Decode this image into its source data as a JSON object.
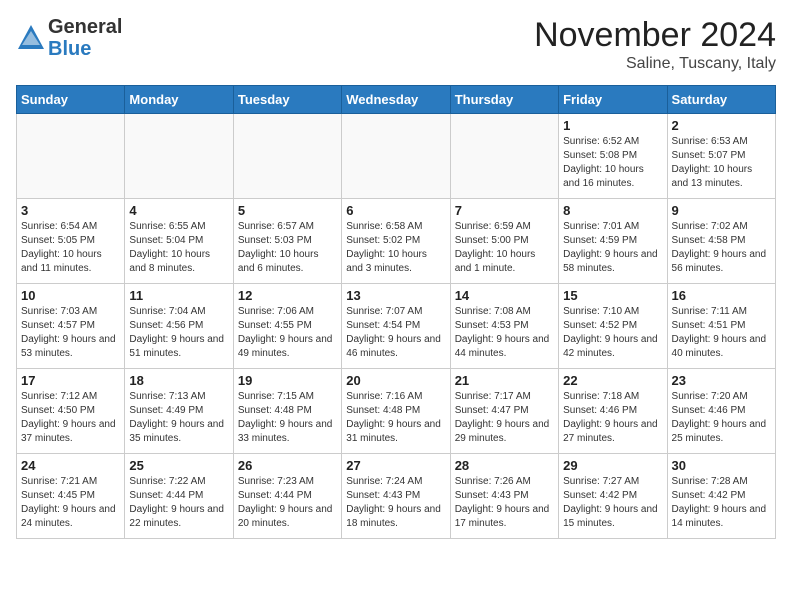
{
  "header": {
    "logo_line1": "General",
    "logo_line2": "Blue",
    "month": "November 2024",
    "location": "Saline, Tuscany, Italy"
  },
  "columns": [
    "Sunday",
    "Monday",
    "Tuesday",
    "Wednesday",
    "Thursday",
    "Friday",
    "Saturday"
  ],
  "weeks": [
    [
      {
        "day": "",
        "info": ""
      },
      {
        "day": "",
        "info": ""
      },
      {
        "day": "",
        "info": ""
      },
      {
        "day": "",
        "info": ""
      },
      {
        "day": "",
        "info": ""
      },
      {
        "day": "1",
        "info": "Sunrise: 6:52 AM\nSunset: 5:08 PM\nDaylight: 10 hours and 16 minutes."
      },
      {
        "day": "2",
        "info": "Sunrise: 6:53 AM\nSunset: 5:07 PM\nDaylight: 10 hours and 13 minutes."
      }
    ],
    [
      {
        "day": "3",
        "info": "Sunrise: 6:54 AM\nSunset: 5:05 PM\nDaylight: 10 hours and 11 minutes."
      },
      {
        "day": "4",
        "info": "Sunrise: 6:55 AM\nSunset: 5:04 PM\nDaylight: 10 hours and 8 minutes."
      },
      {
        "day": "5",
        "info": "Sunrise: 6:57 AM\nSunset: 5:03 PM\nDaylight: 10 hours and 6 minutes."
      },
      {
        "day": "6",
        "info": "Sunrise: 6:58 AM\nSunset: 5:02 PM\nDaylight: 10 hours and 3 minutes."
      },
      {
        "day": "7",
        "info": "Sunrise: 6:59 AM\nSunset: 5:00 PM\nDaylight: 10 hours and 1 minute."
      },
      {
        "day": "8",
        "info": "Sunrise: 7:01 AM\nSunset: 4:59 PM\nDaylight: 9 hours and 58 minutes."
      },
      {
        "day": "9",
        "info": "Sunrise: 7:02 AM\nSunset: 4:58 PM\nDaylight: 9 hours and 56 minutes."
      }
    ],
    [
      {
        "day": "10",
        "info": "Sunrise: 7:03 AM\nSunset: 4:57 PM\nDaylight: 9 hours and 53 minutes."
      },
      {
        "day": "11",
        "info": "Sunrise: 7:04 AM\nSunset: 4:56 PM\nDaylight: 9 hours and 51 minutes."
      },
      {
        "day": "12",
        "info": "Sunrise: 7:06 AM\nSunset: 4:55 PM\nDaylight: 9 hours and 49 minutes."
      },
      {
        "day": "13",
        "info": "Sunrise: 7:07 AM\nSunset: 4:54 PM\nDaylight: 9 hours and 46 minutes."
      },
      {
        "day": "14",
        "info": "Sunrise: 7:08 AM\nSunset: 4:53 PM\nDaylight: 9 hours and 44 minutes."
      },
      {
        "day": "15",
        "info": "Sunrise: 7:10 AM\nSunset: 4:52 PM\nDaylight: 9 hours and 42 minutes."
      },
      {
        "day": "16",
        "info": "Sunrise: 7:11 AM\nSunset: 4:51 PM\nDaylight: 9 hours and 40 minutes."
      }
    ],
    [
      {
        "day": "17",
        "info": "Sunrise: 7:12 AM\nSunset: 4:50 PM\nDaylight: 9 hours and 37 minutes."
      },
      {
        "day": "18",
        "info": "Sunrise: 7:13 AM\nSunset: 4:49 PM\nDaylight: 9 hours and 35 minutes."
      },
      {
        "day": "19",
        "info": "Sunrise: 7:15 AM\nSunset: 4:48 PM\nDaylight: 9 hours and 33 minutes."
      },
      {
        "day": "20",
        "info": "Sunrise: 7:16 AM\nSunset: 4:48 PM\nDaylight: 9 hours and 31 minutes."
      },
      {
        "day": "21",
        "info": "Sunrise: 7:17 AM\nSunset: 4:47 PM\nDaylight: 9 hours and 29 minutes."
      },
      {
        "day": "22",
        "info": "Sunrise: 7:18 AM\nSunset: 4:46 PM\nDaylight: 9 hours and 27 minutes."
      },
      {
        "day": "23",
        "info": "Sunrise: 7:20 AM\nSunset: 4:46 PM\nDaylight: 9 hours and 25 minutes."
      }
    ],
    [
      {
        "day": "24",
        "info": "Sunrise: 7:21 AM\nSunset: 4:45 PM\nDaylight: 9 hours and 24 minutes."
      },
      {
        "day": "25",
        "info": "Sunrise: 7:22 AM\nSunset: 4:44 PM\nDaylight: 9 hours and 22 minutes."
      },
      {
        "day": "26",
        "info": "Sunrise: 7:23 AM\nSunset: 4:44 PM\nDaylight: 9 hours and 20 minutes."
      },
      {
        "day": "27",
        "info": "Sunrise: 7:24 AM\nSunset: 4:43 PM\nDaylight: 9 hours and 18 minutes."
      },
      {
        "day": "28",
        "info": "Sunrise: 7:26 AM\nSunset: 4:43 PM\nDaylight: 9 hours and 17 minutes."
      },
      {
        "day": "29",
        "info": "Sunrise: 7:27 AM\nSunset: 4:42 PM\nDaylight: 9 hours and 15 minutes."
      },
      {
        "day": "30",
        "info": "Sunrise: 7:28 AM\nSunset: 4:42 PM\nDaylight: 9 hours and 14 minutes."
      }
    ]
  ]
}
